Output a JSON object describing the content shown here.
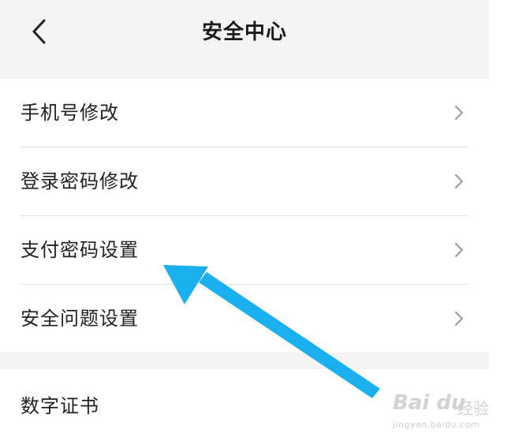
{
  "header": {
    "title": "安全中心",
    "back_icon": "chevron-left-icon"
  },
  "security_menu": {
    "items": [
      {
        "label": "手机号修改",
        "icon": "chevron-right-icon"
      },
      {
        "label": "登录密码修改",
        "icon": "chevron-right-icon"
      },
      {
        "label": "支付密码设置",
        "icon": "chevron-right-icon"
      },
      {
        "label": "安全问题设置",
        "icon": "chevron-right-icon"
      }
    ]
  },
  "certificate_menu": {
    "items": [
      {
        "label": "数字证书"
      }
    ]
  },
  "annotation": {
    "arrow_color": "#1ab0f0",
    "points_to": "支付密码设置"
  },
  "watermark": {
    "brand": "Bai du",
    "sub": "经验",
    "url": "jingyan.baidu.com"
  },
  "colors": {
    "background": "#f3f3f3",
    "card": "#ffffff",
    "divider": "#e2e2e2",
    "chevron": "#9a9a9a"
  }
}
